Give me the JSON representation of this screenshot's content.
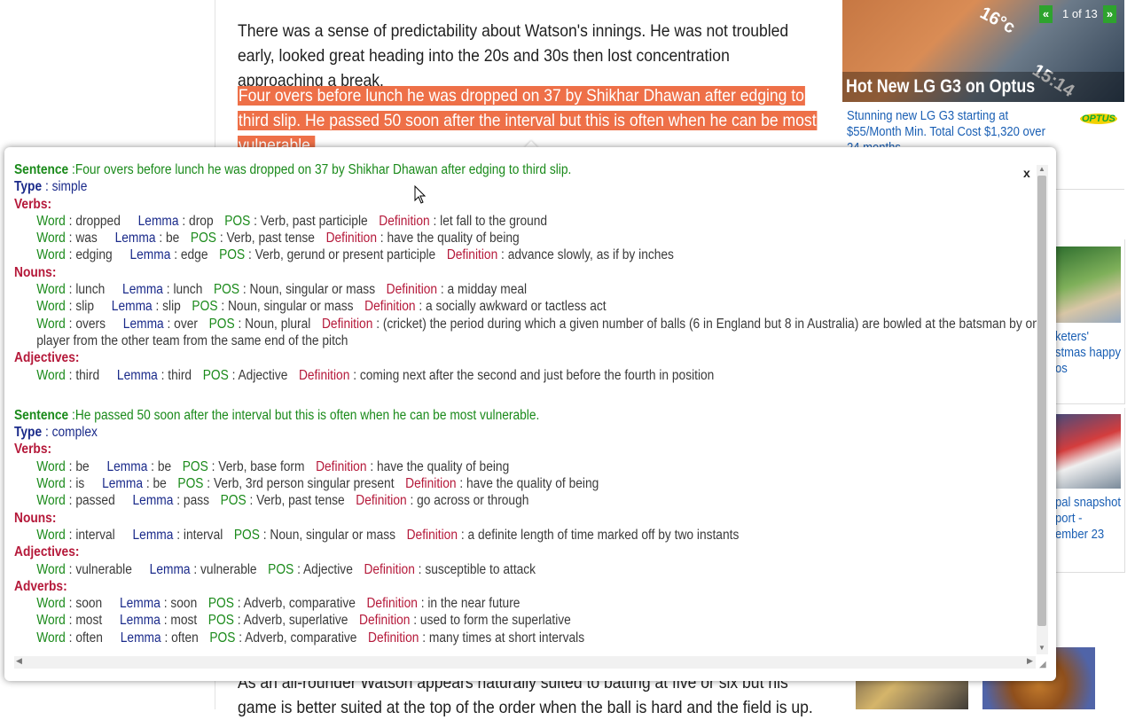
{
  "article": {
    "para1": "There was a sense of predictability about Watson's innings. He was not troubled early, looked great heading into the 20s and 30s then lost concentration approaching a break.",
    "para2_highlighted": "Four overs before lunch he was dropped on 37 by Shikhar Dhawan after edging to third slip. He passed 50 soon after the interval but this is often when he can be most vulnerable.",
    "para3": "As an all-rounder Watson appears naturally suited to batting at five or six but his game is better suited at the top of the order when the ball is hard and the field is up."
  },
  "ad": {
    "title": "Hot New LG G3 on Optus",
    "pager": "1 of 13",
    "prev_icon": "«",
    "next_icon": "»",
    "subtitle": "Stunning new LG G3 starting at $55/Month Min. Total Cost $1,320 over 24 months",
    "brand": "OPTUS",
    "phone_text_1": "16°c",
    "phone_text_2": "15:14"
  },
  "sidebar": {
    "item1_lines": [
      "keters'",
      "stmas happy",
      "os"
    ],
    "item2_lines": [
      "pal snapshot",
      "port -",
      "ember 23"
    ]
  },
  "popup": {
    "close_label": "x",
    "labels": {
      "sentence": "Sentence",
      "type": "Type",
      "word": "Word",
      "lemma": "Lemma",
      "pos": "POS",
      "definition": "Definition"
    },
    "sentences": [
      {
        "text": "Four overs before lunch he was dropped on 37 by Shikhar Dhawan after edging to third slip.",
        "type": "simple",
        "groups": [
          {
            "label": "Verbs:",
            "words": [
              {
                "word": "dropped",
                "lemma": "drop",
                "pos": "Verb, past participle",
                "definition": "let fall to the ground"
              },
              {
                "word": "was",
                "lemma": "be",
                "pos": "Verb, past tense",
                "definition": "have the quality of being"
              },
              {
                "word": "edging",
                "lemma": "edge",
                "pos": "Verb, gerund or present participle",
                "definition": "advance slowly, as if by inches"
              }
            ]
          },
          {
            "label": "Nouns:",
            "words": [
              {
                "word": "lunch",
                "lemma": "lunch",
                "pos": "Noun, singular or mass",
                "definition": "a midday meal"
              },
              {
                "word": "slip",
                "lemma": "slip",
                "pos": "Noun, singular or mass",
                "definition": "a socially awkward or tactless act"
              },
              {
                "word": "overs",
                "lemma": "over",
                "pos": "Noun, plural",
                "definition": "(cricket) the period during which a given number of balls (6 in England but 8 in Australia) are bowled at the batsman by one player from the other team from the same end of the pitch"
              }
            ]
          },
          {
            "label": "Adjectives:",
            "words": [
              {
                "word": "third",
                "lemma": "third",
                "pos": "Adjective",
                "definition": "coming next after the second and just before the fourth in position"
              }
            ]
          }
        ]
      },
      {
        "text": "He passed 50 soon after the interval but this is often when he can be most vulnerable.",
        "type": "complex",
        "groups": [
          {
            "label": "Verbs:",
            "words": [
              {
                "word": "be",
                "lemma": "be",
                "pos": "Verb, base form",
                "definition": "have the quality of being"
              },
              {
                "word": "is",
                "lemma": "be",
                "pos": "Verb, 3rd person singular present",
                "definition": "have the quality of being"
              },
              {
                "word": "passed",
                "lemma": "pass",
                "pos": "Verb, past tense",
                "definition": "go across or through"
              }
            ]
          },
          {
            "label": "Nouns:",
            "words": [
              {
                "word": "interval",
                "lemma": "interval",
                "pos": "Noun, singular or mass",
                "definition": "a definite length of time marked off by two instants"
              }
            ]
          },
          {
            "label": "Adjectives:",
            "words": [
              {
                "word": "vulnerable",
                "lemma": "vulnerable",
                "pos": "Adjective",
                "definition": "susceptible to attack"
              }
            ]
          },
          {
            "label": "Adverbs:",
            "words": [
              {
                "word": "soon",
                "lemma": "soon",
                "pos": "Adverb, comparative",
                "definition": "in the near future"
              },
              {
                "word": "most",
                "lemma": "most",
                "pos": "Adverb, superlative",
                "definition": "used to form the superlative"
              },
              {
                "word": "often",
                "lemma": "often",
                "pos": "Adverb, comparative",
                "definition": "many times at short intervals"
              }
            ]
          }
        ]
      }
    ]
  },
  "colors": {
    "highlight": "#ee7048",
    "sentence_green": "#1a8a1a",
    "type_blue": "#1a2a8a",
    "group_red": "#b5193a",
    "link_blue": "#1a5fb4",
    "pager_green": "#2ea32e"
  }
}
